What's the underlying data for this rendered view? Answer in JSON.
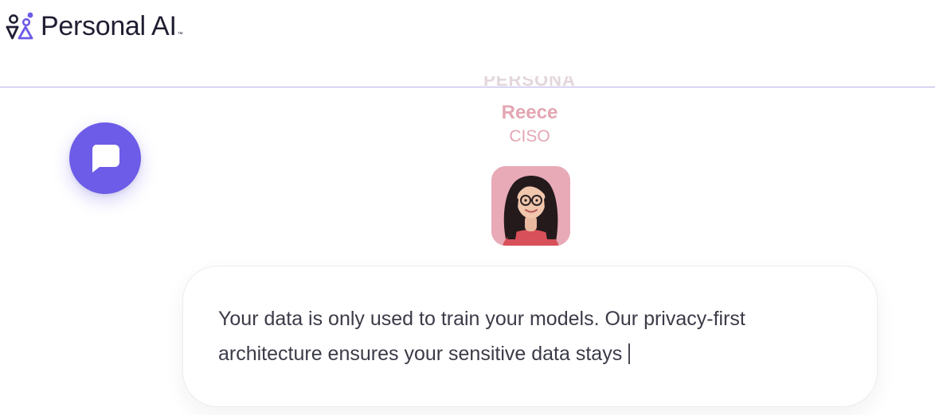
{
  "brand": {
    "name": "Personal AI",
    "trademark": "™",
    "logo_icon": "personal-ai-logo-icon",
    "colors": {
      "primary": "#6c5ce7",
      "text": "#1f1e33",
      "divider": "#b9b2e6"
    }
  },
  "chat_launcher": {
    "icon": "chat-bubble-icon"
  },
  "persona": {
    "kicker": "PERSONA",
    "name": "Reece",
    "role": "CISO",
    "accent_color": "#e3a6b3"
  },
  "message": {
    "text": "Your data is only used to train your models. Our privacy-first architecture ensures your sensitive data stays"
  }
}
